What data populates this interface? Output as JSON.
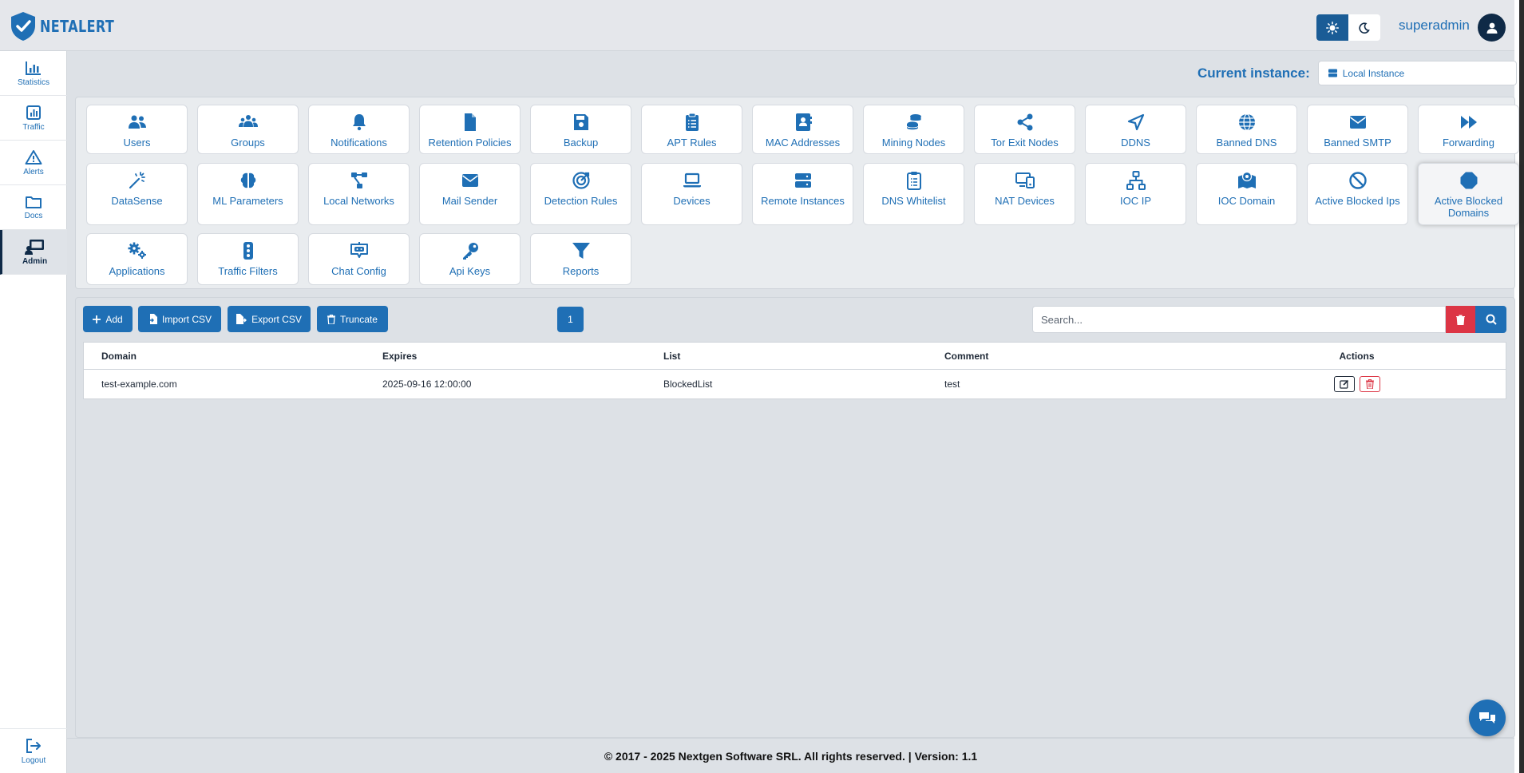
{
  "app": {
    "name": "NETALERT"
  },
  "header": {
    "user": "superadmin",
    "theme_light_icon": "sun-icon",
    "theme_dark_icon": "moon-icon"
  },
  "sidebar": {
    "items": [
      {
        "label": "Statistics",
        "icon": "bar-chart-icon"
      },
      {
        "label": "Traffic",
        "icon": "line-chart-icon"
      },
      {
        "label": "Alerts",
        "icon": "warning-icon"
      },
      {
        "label": "Docs",
        "icon": "folder-icon"
      },
      {
        "label": "Admin",
        "icon": "admin-screen-icon",
        "active": true
      }
    ],
    "logout": "Logout"
  },
  "instance": {
    "label": "Current instance:",
    "value": "Local Instance"
  },
  "tiles": [
    {
      "label": "Users",
      "icon": "users-icon"
    },
    {
      "label": "Groups",
      "icon": "groups-icon"
    },
    {
      "label": "Notifications",
      "icon": "bell-icon"
    },
    {
      "label": "Retention Policies",
      "icon": "file-icon"
    },
    {
      "label": "Backup",
      "icon": "floppy-icon"
    },
    {
      "label": "APT Rules",
      "icon": "clipboard-list-icon"
    },
    {
      "label": "MAC Addresses",
      "icon": "address-card-icon"
    },
    {
      "label": "Mining Nodes",
      "icon": "coins-icon"
    },
    {
      "label": "Tor Exit Nodes",
      "icon": "share-nodes-icon"
    },
    {
      "label": "DDNS",
      "icon": "location-arrow-icon"
    },
    {
      "label": "Banned DNS",
      "icon": "globe-icon"
    },
    {
      "label": "Banned SMTP",
      "icon": "envelope-icon"
    },
    {
      "label": "Forwarding",
      "icon": "fast-forward-icon"
    },
    {
      "label": "DataSense",
      "icon": "sparkle-wand-icon"
    },
    {
      "label": "ML Parameters",
      "icon": "brain-icon"
    },
    {
      "label": "Local Networks",
      "icon": "network-icon"
    },
    {
      "label": "Mail Sender",
      "icon": "envelope-icon"
    },
    {
      "label": "Detection Rules",
      "icon": "target-icon"
    },
    {
      "label": "Devices",
      "icon": "laptop-icon"
    },
    {
      "label": "Remote Instances",
      "icon": "server-icon"
    },
    {
      "label": "DNS Whitelist",
      "icon": "clipboard-check-icon"
    },
    {
      "label": "NAT Devices",
      "icon": "devices-icon"
    },
    {
      "label": "IOC IP",
      "icon": "sitemap-icon"
    },
    {
      "label": "IOC Domain",
      "icon": "map-location-icon"
    },
    {
      "label": "Active Blocked Ips",
      "icon": "ban-icon"
    },
    {
      "label": "Active Blocked Domains",
      "icon": "octagon-icon",
      "selected": true
    },
    {
      "label": "Applications",
      "icon": "gears-icon"
    },
    {
      "label": "Traffic Filters",
      "icon": "traffic-light-icon"
    },
    {
      "label": "Chat Config",
      "icon": "chat-bot-icon"
    },
    {
      "label": "Api Keys",
      "icon": "key-icon"
    },
    {
      "label": "Reports",
      "icon": "filter-icon"
    }
  ],
  "toolbar": {
    "add": "Add",
    "import": "Import CSV",
    "export": "Export CSV",
    "truncate": "Truncate",
    "page": "1",
    "search_placeholder": "Search..."
  },
  "table": {
    "headers": {
      "domain": "Domain",
      "expires": "Expires",
      "list": "List",
      "comment": "Comment",
      "actions": "Actions"
    },
    "rows": [
      {
        "domain": "test-example.com",
        "expires": "2025-09-16 12:00:00",
        "list": "BlockedList",
        "comment": "test"
      }
    ]
  },
  "footer": {
    "text": "© 2017 - 2025 Nextgen Software SRL. All rights reserved. | Version: 1.1"
  },
  "colors": {
    "primary": "#1f6fb5",
    "dark": "#0f2a47",
    "danger": "#dc3545",
    "background": "#dde1e6"
  }
}
